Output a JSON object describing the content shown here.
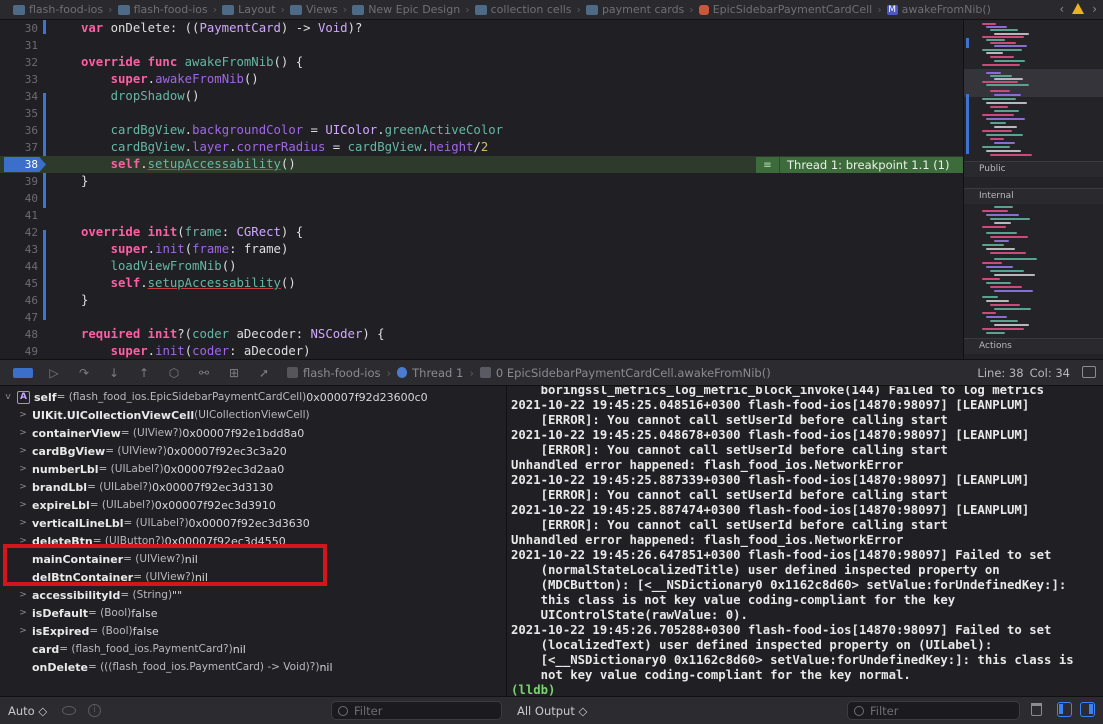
{
  "jumpbar": {
    "crumbs": [
      "flash-food-ios",
      "flash-food-ios",
      "Layout",
      "Views",
      "New Epic Design",
      "collection cells",
      "payment cards",
      "EpicSidebarPaymentCardCell",
      "awakeFromNib()"
    ],
    "back": "‹",
    "fwd": "›"
  },
  "editor": {
    "lines": [
      {
        "n": "30",
        "tokens": [
          [
            "kw",
            "var "
          ],
          [
            "pl",
            "onDelete: (("
          ],
          [
            "ty",
            "PaymentCard"
          ],
          [
            "pl",
            ") -> "
          ],
          [
            "ty",
            "Void"
          ],
          [
            "pl",
            ")?"
          ]
        ]
      },
      {
        "n": "31",
        "tokens": []
      },
      {
        "n": "32",
        "tokens": [
          [
            "kw",
            "override func "
          ],
          [
            "fn",
            "awakeFromNib"
          ],
          [
            "pl",
            "() {"
          ]
        ]
      },
      {
        "n": "33",
        "tokens": [
          [
            "pl",
            "    "
          ],
          [
            "kw",
            "super"
          ],
          [
            "pl",
            "."
          ],
          [
            "sf",
            "awakeFromNib"
          ],
          [
            "pl",
            "()"
          ]
        ]
      },
      {
        "n": "34",
        "tokens": [
          [
            "pl",
            "    "
          ],
          [
            "pr",
            "dropShadow"
          ],
          [
            "pl",
            "()"
          ]
        ]
      },
      {
        "n": "35",
        "tokens": []
      },
      {
        "n": "36",
        "tokens": [
          [
            "pl",
            "    "
          ],
          [
            "pr",
            "cardBgView"
          ],
          [
            "pl",
            "."
          ],
          [
            "sf",
            "backgroundColor"
          ],
          [
            "pl",
            " = "
          ],
          [
            "ty",
            "UIColor"
          ],
          [
            "pl",
            "."
          ],
          [
            "pr",
            "greenActiveColor"
          ]
        ]
      },
      {
        "n": "37",
        "tokens": [
          [
            "pl",
            "    "
          ],
          [
            "pr",
            "cardBgView"
          ],
          [
            "pl",
            "."
          ],
          [
            "sf",
            "layer"
          ],
          [
            "pl",
            "."
          ],
          [
            "sf",
            "cornerRadius"
          ],
          [
            "pl",
            " = "
          ],
          [
            "pr",
            "cardBgView"
          ],
          [
            "pl",
            "."
          ],
          [
            "sf",
            "height"
          ],
          [
            "pl",
            "/"
          ],
          [
            "num",
            "2"
          ]
        ]
      },
      {
        "n": "38",
        "tokens": [
          [
            "pl",
            "    "
          ],
          [
            "kw",
            "self"
          ],
          [
            "pl",
            "."
          ],
          [
            "pr ul",
            "setupAccessability"
          ],
          [
            "pl",
            "()"
          ]
        ],
        "active": true
      },
      {
        "n": "39",
        "tokens": [
          [
            "pl",
            "}"
          ]
        ]
      },
      {
        "n": "40",
        "tokens": []
      },
      {
        "n": "41",
        "tokens": []
      },
      {
        "n": "42",
        "tokens": [
          [
            "kw",
            "override init"
          ],
          [
            "pl",
            "("
          ],
          [
            "fn",
            "frame"
          ],
          [
            "pl",
            ": "
          ],
          [
            "ty",
            "CGRect"
          ],
          [
            "pl",
            ") {"
          ]
        ]
      },
      {
        "n": "43",
        "tokens": [
          [
            "pl",
            "    "
          ],
          [
            "kw",
            "super"
          ],
          [
            "pl",
            "."
          ],
          [
            "sf",
            "init"
          ],
          [
            "pl",
            "("
          ],
          [
            "sf",
            "frame"
          ],
          [
            "pl",
            ": frame)"
          ]
        ]
      },
      {
        "n": "44",
        "tokens": [
          [
            "pl",
            "    "
          ],
          [
            "pr",
            "loadViewFromNib"
          ],
          [
            "pl",
            "()"
          ]
        ]
      },
      {
        "n": "45",
        "tokens": [
          [
            "pl",
            "    "
          ],
          [
            "kw",
            "self"
          ],
          [
            "pl",
            "."
          ],
          [
            "pr ul",
            "setupAccessability"
          ],
          [
            "pl",
            "()"
          ]
        ]
      },
      {
        "n": "46",
        "tokens": [
          [
            "pl",
            "}"
          ]
        ]
      },
      {
        "n": "47",
        "tokens": []
      },
      {
        "n": "48",
        "tokens": [
          [
            "kw",
            "required init"
          ],
          [
            "pl",
            "?("
          ],
          [
            "fn",
            "coder"
          ],
          [
            "pl",
            " aDecoder: "
          ],
          [
            "ty",
            "NSCoder"
          ],
          [
            "pl",
            ") {"
          ]
        ]
      },
      {
        "n": "49",
        "tokens": [
          [
            "pl",
            "    "
          ],
          [
            "kw",
            "super"
          ],
          [
            "pl",
            "."
          ],
          [
            "sf",
            "init"
          ],
          [
            "pl",
            "("
          ],
          [
            "sf",
            "coder"
          ],
          [
            "pl",
            ": aDecoder)"
          ]
        ]
      }
    ],
    "banner": "Thread 1: breakpoint 1.1 (1)"
  },
  "minimap": {
    "sections": [
      "Public",
      "Internal",
      "Actions"
    ]
  },
  "debugbar": {
    "crumbs": [
      "flash-food-ios",
      "Thread 1",
      "0 EpicSidebarPaymentCardCell.awakeFromNib()"
    ],
    "line": "Line: 38",
    "col": "Col: 34"
  },
  "variables": [
    {
      "disclosure": "v",
      "badge": "A",
      "name": "self",
      "type": " = (flash_food_ios.EpicSidebarPaymentCardCell) ",
      "value": "0x00007f92d23600c0",
      "indent": 0
    },
    {
      "disclosure": ">",
      "name": "UIKit.UICollectionViewCell",
      "type": " (UICollectionViewCell)",
      "value": "",
      "indent": 1
    },
    {
      "disclosure": ">",
      "name": "containerView",
      "type": " = (UIView?) ",
      "value": "0x00007f92e1bdd8a0",
      "indent": 1
    },
    {
      "disclosure": ">",
      "name": "cardBgView",
      "type": " = (UIView?) ",
      "value": "0x00007f92ec3c3a20",
      "indent": 1
    },
    {
      "disclosure": ">",
      "name": "numberLbl",
      "type": " = (UILabel?) ",
      "value": "0x00007f92ec3d2aa0",
      "indent": 1
    },
    {
      "disclosure": ">",
      "name": "brandLbl",
      "type": " = (UILabel?) ",
      "value": "0x00007f92ec3d3130",
      "indent": 1
    },
    {
      "disclosure": ">",
      "name": "expireLbl",
      "type": " = (UILabel?) ",
      "value": "0x00007f92ec3d3910",
      "indent": 1
    },
    {
      "disclosure": ">",
      "name": "verticalLineLbl",
      "type": " = (UILabel?) ",
      "value": "0x00007f92ec3d3630",
      "indent": 1
    },
    {
      "disclosure": ">",
      "name": "deleteBtn",
      "type": " = (UIButton?) ",
      "value": "0x00007f92ec3d4550",
      "indent": 1
    },
    {
      "disclosure": "",
      "name": "mainContainer",
      "type": " = (UIView?) ",
      "value": "nil",
      "indent": 1
    },
    {
      "disclosure": "",
      "name": "delBtnContainer",
      "type": " = (UIView?) ",
      "value": "nil",
      "indent": 1
    },
    {
      "disclosure": ">",
      "name": "accessibilityId",
      "type": " = (String) ",
      "value": "\"\"",
      "indent": 1
    },
    {
      "disclosure": ">",
      "name": "isDefault",
      "type": " = (Bool) ",
      "value": "false",
      "indent": 1
    },
    {
      "disclosure": ">",
      "name": "isExpired",
      "type": " = (Bool) ",
      "value": "false",
      "indent": 1
    },
    {
      "disclosure": "",
      "name": "card",
      "type": " = (flash_food_ios.PaymentCard?) ",
      "value": "nil",
      "indent": 1
    },
    {
      "disclosure": "",
      "name": "onDelete",
      "type": " = (((flash_food_ios.PaymentCard) -> Void)?) ",
      "value": "nil",
      "indent": 1
    }
  ],
  "console": {
    "lines": [
      "    boringssl_metrics_log_metric_block_invoke(144) Failed to log metrics",
      "2021-10-22 19:45:25.048516+0300 flash-food-ios[14870:98097] [LEANPLUM]",
      "    [ERROR]: You cannot call setUserId before calling start",
      "2021-10-22 19:45:25.048678+0300 flash-food-ios[14870:98097] [LEANPLUM]",
      "    [ERROR]: You cannot call setUserId before calling start",
      "Unhandled error happened: flash_food_ios.NetworkError",
      "2021-10-22 19:45:25.887339+0300 flash-food-ios[14870:98097] [LEANPLUM]",
      "    [ERROR]: You cannot call setUserId before calling start",
      "2021-10-22 19:45:25.887474+0300 flash-food-ios[14870:98097] [LEANPLUM]",
      "    [ERROR]: You cannot call setUserId before calling start",
      "Unhandled error happened: flash_food_ios.NetworkError",
      "2021-10-22 19:45:26.647851+0300 flash-food-ios[14870:98097] Failed to set",
      "    (normalStateLocalizedTitle) user defined inspected property on",
      "    (MDCButton): [<__NSDictionary0 0x1162c8d60> setValue:forUndefinedKey:]:",
      "    this class is not key value coding-compliant for the key",
      "    UIControlState(rawValue: 0).",
      "2021-10-22 19:45:26.705288+0300 flash-food-ios[14870:98097] Failed to set",
      "    (localizedText) user defined inspected property on (UILabel):",
      "    [<__NSDictionary0 0x1162c8d60> setValue:forUndefinedKey:]: this class is",
      "    not key value coding-compliant for the key normal."
    ],
    "prompt": "(lldb)"
  },
  "bottombar": {
    "auto": "Auto ◇",
    "filter_left": "Filter",
    "all_output": "All Output ◇",
    "filter_right": "Filter"
  }
}
